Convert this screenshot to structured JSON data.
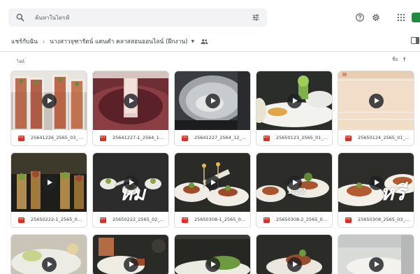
{
  "search": {
    "placeholder": "ค้นหาในไดรฟ์"
  },
  "header": {
    "icons": [
      "help-icon",
      "settings-icon",
      "apps-icon",
      "account-avatar"
    ]
  },
  "breadcrumb": {
    "root": "แชร์กับฉัน",
    "current": "นางสาวจุฑารัตน์ แดนคำ คลาสสอนออนไลน์ (ฝึกงาน)"
  },
  "section": {
    "label": "ไฟล์"
  },
  "sort": {
    "label": "ชื่อ",
    "direction": "ascending"
  },
  "files": [
    {
      "name": "25641226_2565_03_2...",
      "type": "video"
    },
    {
      "name": "25641227-1_2564_12_...",
      "type": "video"
    },
    {
      "name": "25641227_2564_12_2...",
      "type": "video"
    },
    {
      "name": "25650123_2565_01_2...",
      "type": "video"
    },
    {
      "name": "25650124_2565_01_2...",
      "type": "video"
    },
    {
      "name": "25650222-1_2565_02_...",
      "type": "video"
    },
    {
      "name": "25650222_2565_02_2...",
      "type": "video"
    },
    {
      "name": "25650308-1_2565_03_...",
      "type": "video"
    },
    {
      "name": "25650308-2_2565_03_...",
      "type": "video"
    },
    {
      "name": "25650308_2565_03_2...",
      "type": "video"
    }
  ],
  "thumb_overlays": {
    "file6": "หม",
    "file9": "1:22",
    "file10": "หรี"
  },
  "colors": {
    "video_icon": "#d93025",
    "search_bg": "#f1f3f4",
    "border": "#dadce0"
  }
}
